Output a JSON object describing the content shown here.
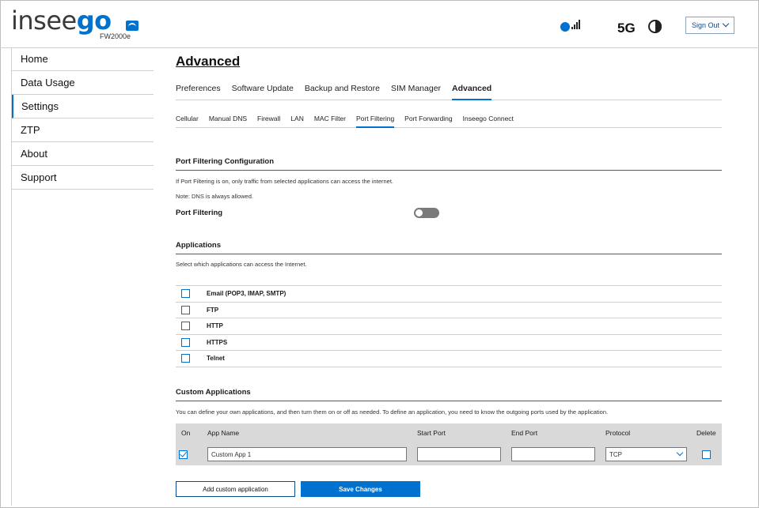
{
  "brand": {
    "logo_part1": "insee",
    "logo_part2": "go",
    "model": "FW2000e"
  },
  "status": {
    "network": "5G",
    "sign_out": "Sign Out",
    "icons": [
      "signal-icon",
      "battery-icon",
      "router-icon"
    ]
  },
  "sidebar": {
    "items": [
      {
        "label": "Home"
      },
      {
        "label": "Data Usage"
      },
      {
        "label": "Settings",
        "active": true
      },
      {
        "label": "ZTP"
      },
      {
        "label": "About"
      },
      {
        "label": "Support"
      }
    ]
  },
  "page": {
    "title": "Advanced",
    "tabs": [
      {
        "label": "Preferences"
      },
      {
        "label": "Software Update"
      },
      {
        "label": "Backup and Restore"
      },
      {
        "label": "SIM Manager"
      },
      {
        "label": "Advanced",
        "active": true
      }
    ],
    "subtabs": [
      {
        "label": "Cellular"
      },
      {
        "label": "Manual DNS"
      },
      {
        "label": "Firewall"
      },
      {
        "label": "LAN"
      },
      {
        "label": "MAC Filter"
      },
      {
        "label": "Port Filtering",
        "active": true
      },
      {
        "label": "Port Forwarding"
      },
      {
        "label": "Inseego Connect"
      }
    ]
  },
  "config": {
    "title": "Port Filtering Configuration",
    "desc": "If Port Filtering is on, only traffic from selected applications can access the internet.",
    "note": "Note: DNS is always allowed.",
    "toggle_label": "Port Filtering",
    "toggle_on": false
  },
  "applications": {
    "title": "Applications",
    "desc": "Select which applications can access the Internet.",
    "items": [
      {
        "label": "Email (POP3, IMAP, SMTP)",
        "checked": false
      },
      {
        "label": "FTP",
        "checked": false
      },
      {
        "label": "HTTP",
        "checked": false
      },
      {
        "label": "HTTPS",
        "checked": false
      },
      {
        "label": "Telnet",
        "checked": false
      }
    ]
  },
  "custom": {
    "title": "Custom Applications",
    "desc": "You can define your own applications, and then turn them on or off as needed. To define an application, you need to know the outgoing ports used by the application.",
    "headers": {
      "on": "On",
      "app_name": "App Name",
      "start_port": "Start Port",
      "end_port": "End Port",
      "protocol": "Protocol",
      "delete": "Delete"
    },
    "rows": [
      {
        "on": true,
        "app_name": "Custom App 1",
        "start_port": "",
        "end_port": "",
        "protocol": "TCP",
        "delete": false
      }
    ]
  },
  "buttons": {
    "add": "Add custom application",
    "save": "Save Changes"
  },
  "colors": {
    "accent": "#0072ce",
    "header_bg": "#d9d9d9"
  }
}
